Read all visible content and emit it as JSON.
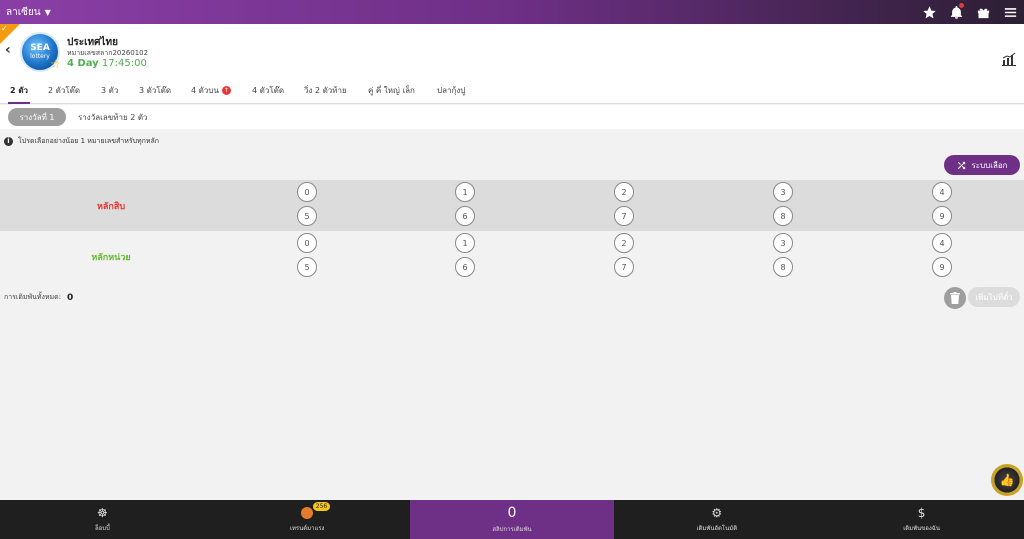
{
  "topbar": {
    "language": "ลาเซียน"
  },
  "header": {
    "logo_line1": "SEA",
    "logo_line2": "lottery",
    "title": "ประเทศไทย",
    "subtitle": "หมายเลขสลาก20260102",
    "countdown_day": "4 Day",
    "countdown_time": "17:45:00"
  },
  "tabs": [
    {
      "label": "2 ตัว",
      "active": true
    },
    {
      "label": "2 ตัวโต๊ด"
    },
    {
      "label": "3 ตัว"
    },
    {
      "label": "3 ตัวโต๊ด"
    },
    {
      "label": "4 ตัวบน"
    },
    {
      "label": "4 ตัวโต๊ด"
    },
    {
      "label": "วิ่ง 2 ตัวท้าย"
    },
    {
      "label": "คู่ คี่ ใหญ่ เล็ก"
    },
    {
      "label": "ปลากุ้งปู"
    }
  ],
  "subtabs": {
    "active": "รางวัลที่ 1",
    "other": "รางวัลเลขท้าย 2 ตัว"
  },
  "notice": "โปรดเลือกอย่างน้อย 1 หมายเลขสำหรับทุกหลัก",
  "random_button": "ระบบเลือก",
  "rows": [
    {
      "label": "หลักสิบ",
      "numbers": [
        "0",
        "1",
        "2",
        "3",
        "4",
        "5",
        "6",
        "7",
        "8",
        "9"
      ]
    },
    {
      "label": "หลักหน่วย",
      "numbers": [
        "0",
        "1",
        "2",
        "3",
        "4",
        "5",
        "6",
        "7",
        "8",
        "9"
      ]
    }
  ],
  "total": {
    "label": "การเดิมพันทั้งหมด:",
    "value": "0"
  },
  "add_button": "เพิ่มไปที่ตั๋ว",
  "bottom_nav": [
    {
      "label": "ล็อบบี้"
    },
    {
      "label": "เทรนด์มาแรง",
      "badge": "256"
    },
    {
      "label": "สลิปการเดิมพัน",
      "count": "0",
      "active": true
    },
    {
      "label": "เดิมพันอัตโนมัติ"
    },
    {
      "label": "เดิมพันของฉัน"
    }
  ],
  "colors": {
    "brand": "#6e2f86",
    "tens_label": "#e53935",
    "units_label": "#66bb33",
    "countdown": "#4caf50"
  }
}
